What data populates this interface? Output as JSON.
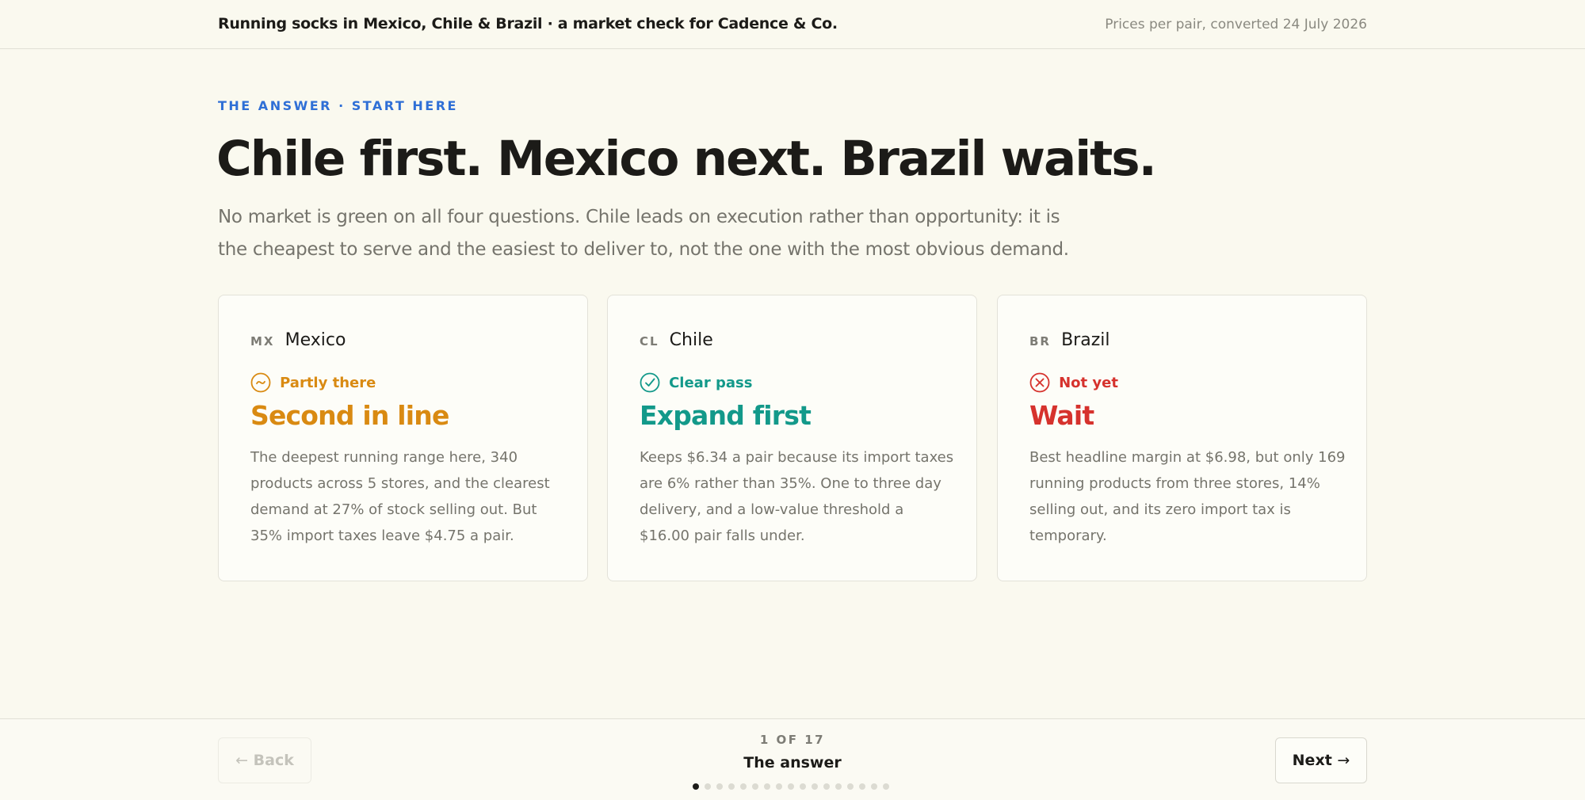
{
  "header": {
    "title": "Running socks in Mexico, Chile & Brazil · a market check for Cadence & Co.",
    "meta": "Prices per pair, converted 24 July 2026"
  },
  "intro": {
    "eyebrow": "THE ANSWER · START HERE",
    "headline": "Chile first. Mexico next. Brazil waits.",
    "lede": "No market is green on all four questions. Chile leads on execution rather than opportunity: it is the cheapest to serve and the easiest to deliver to, not the one with the most obvious demand."
  },
  "cards": [
    {
      "code": "MX",
      "country": "Mexico",
      "status": "Partly there",
      "status_icon": "tilde-circle-icon",
      "color": "#d98a12",
      "verdict": "Second in line",
      "description": "The deepest running range here, 340 products across 5 stores, and the clearest demand at 27% of stock selling out. But 35% import taxes leave $4.75 a pair."
    },
    {
      "code": "CL",
      "country": "Chile",
      "status": "Clear pass",
      "status_icon": "check-circle-icon",
      "color": "#13998a",
      "verdict": "Expand first",
      "description": "Keeps $6.34 a pair because its import taxes are 6% rather than 35%. One to three day delivery, and a low-value threshold a $16.00 pair falls under."
    },
    {
      "code": "BR",
      "country": "Brazil",
      "status": "Not yet",
      "status_icon": "x-circle-icon",
      "color": "#d6322d",
      "verdict": "Wait",
      "description": "Best headline margin at $6.98, but only 169 running products from three stores, 14% selling out, and its zero import tax is temporary."
    }
  ],
  "footer": {
    "back_label": "Back",
    "next_label": "Next",
    "back_icon": "arrow-left-icon",
    "next_icon": "arrow-right-icon",
    "page_current": 1,
    "page_total": 17,
    "page_count_label": "1 OF 17",
    "page_title": "The answer"
  }
}
